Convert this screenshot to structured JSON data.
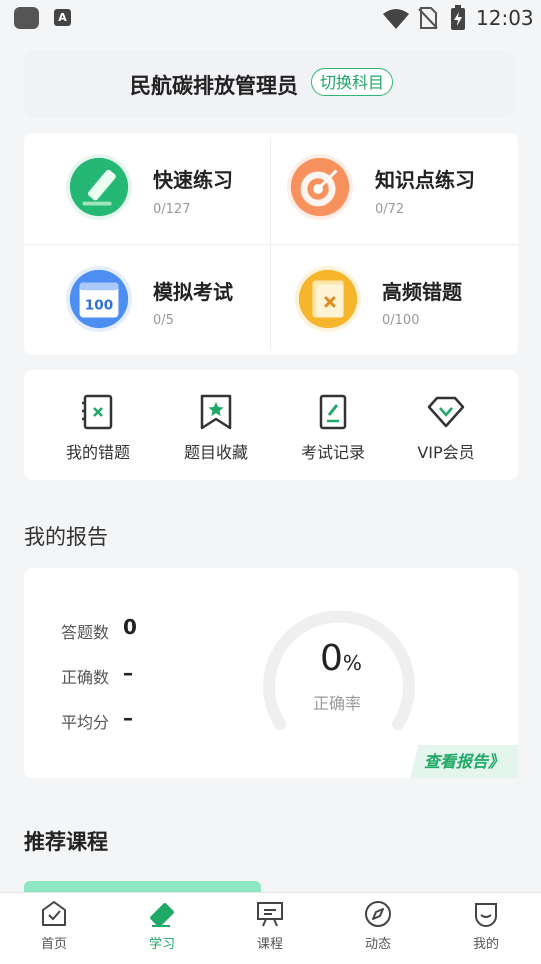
{
  "status_bar": {
    "time": "12:03",
    "app_icon_letter": "A"
  },
  "header": {
    "subject": "民航碳排放管理员",
    "switch_label": "切换科目"
  },
  "practice": [
    {
      "title": "快速练习",
      "progress": "0/127",
      "icon": "pen-icon"
    },
    {
      "title": "知识点练习",
      "progress": "0/72",
      "icon": "target-icon"
    },
    {
      "title": "模拟考试",
      "progress": "0/5",
      "icon": "calendar-100-icon"
    },
    {
      "title": "高频错题",
      "progress": "0/100",
      "icon": "wrong-book-icon"
    }
  ],
  "tools": [
    {
      "label": "我的错题",
      "icon": "wrong-notebook-icon"
    },
    {
      "label": "题目收藏",
      "icon": "bookmark-star-icon"
    },
    {
      "label": "考试记录",
      "icon": "exam-record-icon"
    },
    {
      "label": "VIP会员",
      "icon": "diamond-icon"
    }
  ],
  "report": {
    "title": "我的报告",
    "answered_label": "答题数",
    "answered_value": "0",
    "correct_label": "正确数",
    "correct_value": "–",
    "avg_label": "平均分",
    "avg_value": "–",
    "accuracy_value": "0",
    "accuracy_unit": "%",
    "accuracy_label": "正确率",
    "view_report": "查看报告》"
  },
  "recommend": {
    "title": "推荐课程"
  },
  "nav": [
    {
      "label": "首页",
      "icon": "home-check-icon",
      "active": false
    },
    {
      "label": "学习",
      "icon": "study-pen-icon",
      "active": true
    },
    {
      "label": "课程",
      "icon": "course-board-icon",
      "active": false
    },
    {
      "label": "动态",
      "icon": "compass-icon",
      "active": false
    },
    {
      "label": "我的",
      "icon": "profile-icon",
      "active": false
    }
  ],
  "colors": {
    "accent": "#1fa866",
    "background": "#f4f5f7"
  }
}
